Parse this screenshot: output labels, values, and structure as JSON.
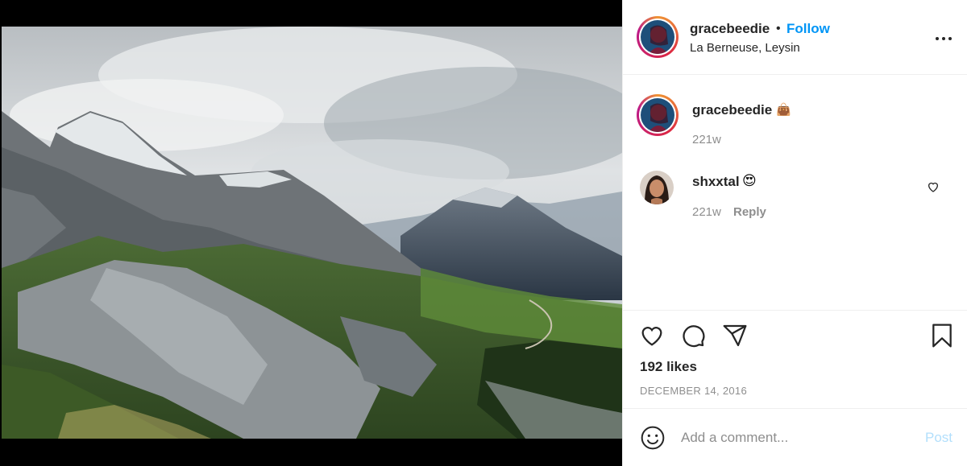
{
  "post": {
    "author": "gracebeedie",
    "follow_label": "Follow",
    "separator": "•",
    "location": "La Berneuse, Leysin",
    "photo_alt": "mountain landscape photo"
  },
  "comments": [
    {
      "username": "gracebeedie",
      "emoji": "👜",
      "age": "221w"
    },
    {
      "username": "shxxtal",
      "emoji": "😍",
      "age": "221w",
      "reply_label": "Reply"
    }
  ],
  "stats": {
    "likes": "192 likes",
    "date": "DECEMBER 14, 2016"
  },
  "comment_box": {
    "placeholder": "Add a comment...",
    "post_label": "Post"
  },
  "colors": {
    "accent": "#0095f6",
    "post_disabled": "#b2dffc",
    "text": "#262626",
    "muted": "#8e8e8e"
  },
  "icons": [
    "more-options-icon",
    "like-heart-icon",
    "comment-icon",
    "share-icon",
    "save-bookmark-icon",
    "emoji-icon",
    "comment-like-icon"
  ]
}
